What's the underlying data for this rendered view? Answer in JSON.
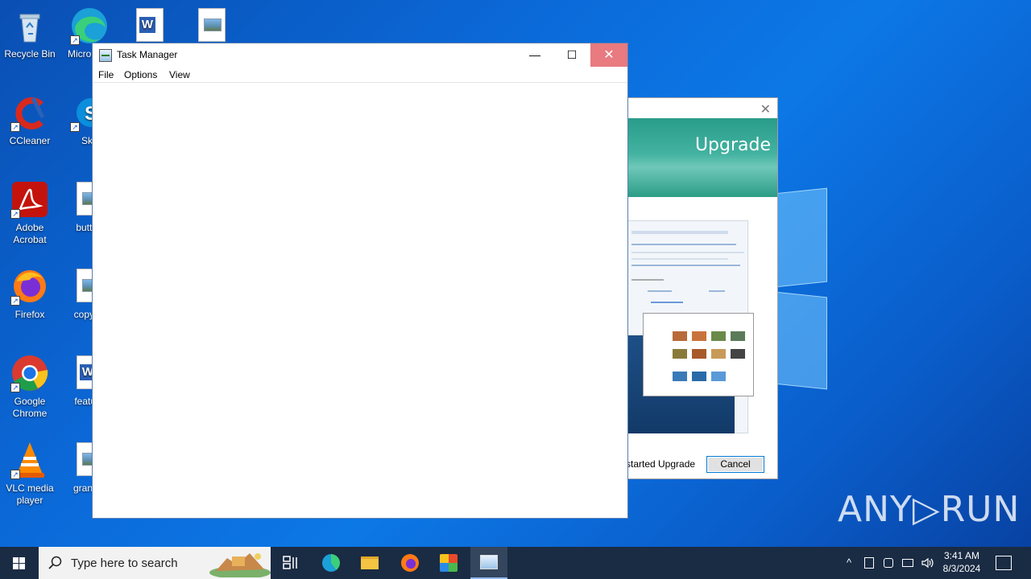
{
  "desktop": {
    "icons": [
      {
        "label": "Recycle Bin"
      },
      {
        "label": "Micro Edg"
      },
      {
        "label": "CCleaner"
      },
      {
        "label": "Sky"
      },
      {
        "label": "Adobe Acrobat"
      },
      {
        "label": "buttod"
      },
      {
        "label": "Firefox"
      },
      {
        "label": "copyrig"
      },
      {
        "label": "Google Chrome"
      },
      {
        "label": "feature"
      },
      {
        "label": "VLC media player"
      },
      {
        "label": "grantva"
      }
    ]
  },
  "upgrade_window": {
    "close_glyph": "✕",
    "banner_title": "Upgrade",
    "footer_text": "started Upgrade",
    "cancel_label": "Cancel"
  },
  "task_manager": {
    "title": "Task Manager",
    "minimize_glyph": "—",
    "maximize_glyph": "☐",
    "close_glyph": "✕",
    "menu": [
      "File",
      "Options",
      "View"
    ]
  },
  "taskbar": {
    "search_placeholder": "Type here to search",
    "clock_time": "3:41 AM",
    "clock_date": "8/3/2024",
    "tray_chevron": "^"
  },
  "watermark": "ANY▷RUN"
}
